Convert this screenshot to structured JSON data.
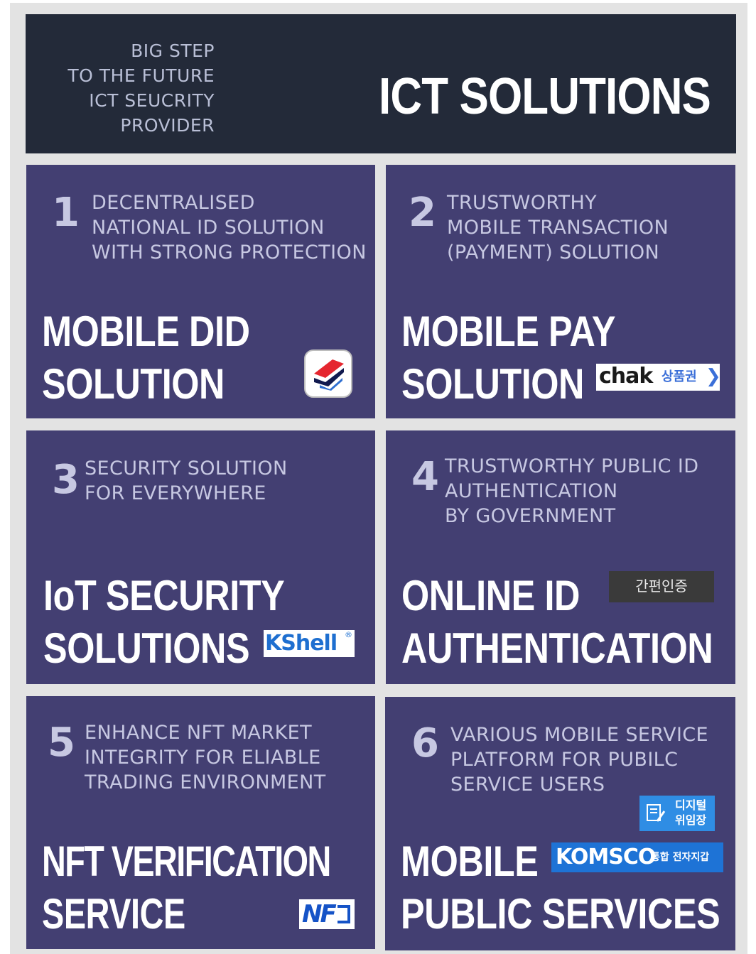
{
  "header": {
    "tagline": [
      "BIG STEP",
      "TO THE FUTURE",
      "ICT SEUCRITY",
      "PROVIDER"
    ],
    "title": "ICT SOLUTIONS"
  },
  "cards": [
    {
      "number": "1",
      "description": [
        "DECENTRALISED",
        "NATIONAL ID SOLUTION",
        "WITH STRONG PROTECTION"
      ],
      "title": [
        "MOBILE DID",
        "SOLUTION"
      ],
      "logo": "mobile-id-app-icon"
    },
    {
      "number": "2",
      "description": [
        "TRUSTWORTHY",
        "MOBILE TRANSACTION",
        "(PAYMENT) SOLUTION"
      ],
      "title": [
        "MOBILE PAY",
        "SOLUTION"
      ],
      "logo": {
        "brand": "chak",
        "suffix": "상품권"
      }
    },
    {
      "number": "3",
      "description": [
        "SECURITY SOLUTION",
        "FOR EVERYWHERE"
      ],
      "title": [
        "IoT SECURITY",
        "SOLUTIONS"
      ],
      "logo": {
        "brand": "KShell",
        "mark": "®"
      }
    },
    {
      "number": "4",
      "description": [
        "TRUSTWORTHY PUBLIC ID",
        "AUTHENTICATION",
        "BY GOVERNMENT"
      ],
      "title": [
        "ONLINE ID",
        "AUTHENTICATION"
      ],
      "logo": {
        "badge": "간편인증"
      }
    },
    {
      "number": "5",
      "description": [
        "ENHANCE NFT MARKET",
        "INTEGRITY FOR ELIABLE",
        "TRADING ENVIRONMENT"
      ],
      "title": [
        "NFT VERIFICATION",
        "SERVICE"
      ],
      "logo": {
        "brand": "NF"
      }
    },
    {
      "number": "6",
      "description": [
        "VARIOUS MOBILE SERVICE",
        "PLATFORM FOR PUBILC",
        "SERVICE USERS"
      ],
      "title": [
        "MOBILE",
        "PUBLIC SERVICES"
      ],
      "logo": {
        "badge_lines": [
          "디지털",
          "위임장"
        ],
        "brand": "KOMSCO",
        "suffix": "통합 전자지갑"
      }
    }
  ],
  "colors": {
    "background": "#e3e3e3",
    "header": "#232a39",
    "card": "#433f72",
    "card_text": "#c7c8e2",
    "title_text": "#ffffff"
  }
}
